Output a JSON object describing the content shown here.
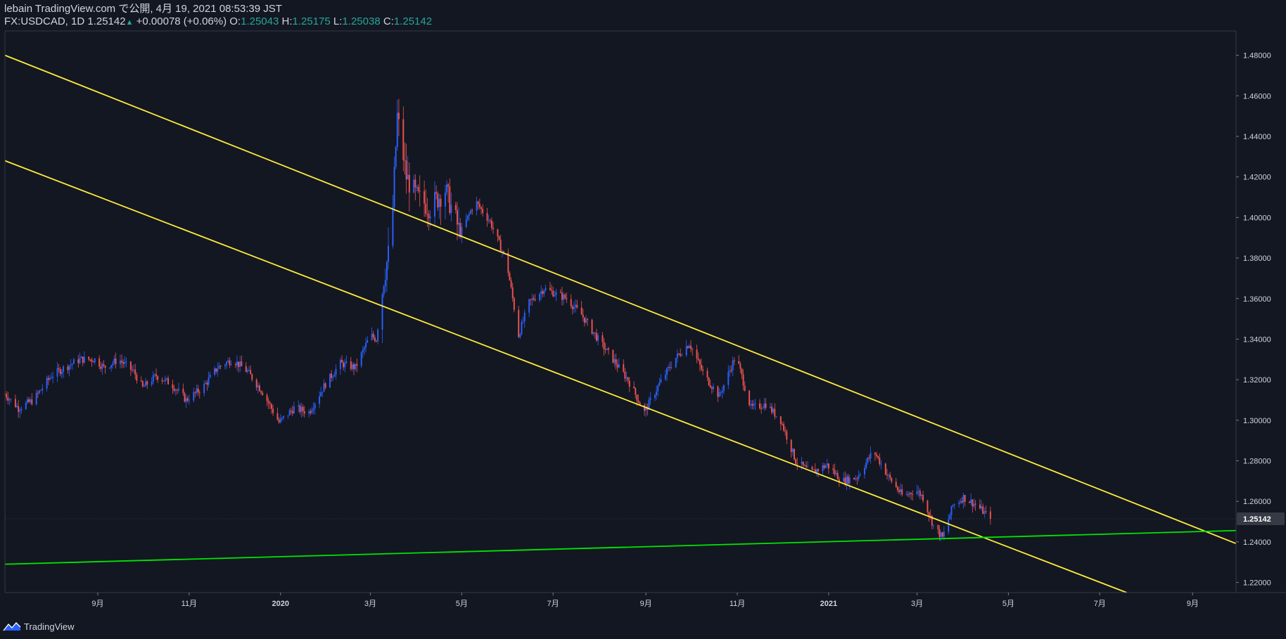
{
  "header": {
    "publisher_line": "lebain TradingView.com で公開, 4月 19, 2021 08:53:39 JST",
    "symbol": "FX:USDCAD, 1D",
    "last": "1.25142",
    "change_arrow": "▲",
    "change": "+0.00078 (+0.06%)",
    "o_label": "O:",
    "o_value": "1.25043",
    "h_label": "H:",
    "h_value": "1.25175",
    "l_label": "L:",
    "l_value": "1.25038",
    "c_label": "C:",
    "c_value": "1.25142"
  },
  "footer": {
    "brand": "TradingView",
    "logo_icon": "tradingview-logo-icon"
  },
  "colors": {
    "background": "#131722",
    "up_candle": "#2962ff",
    "down_candle": "#ef5350",
    "channel_lines": "#ffeb3b",
    "support_line": "#00e600",
    "axis_text": "#d1d4dc",
    "price_label_bg": "#363a45"
  },
  "chart_data": {
    "type": "candlestick",
    "symbol": "FX:USDCAD",
    "interval": "1D",
    "y_axis": {
      "ticks": [
        "1.48000",
        "1.46000",
        "1.44000",
        "1.42000",
        "1.40000",
        "1.38000",
        "1.36000",
        "1.34000",
        "1.32000",
        "1.30000",
        "1.28000",
        "1.26000",
        "1.24000",
        "1.22000"
      ],
      "range": [
        1.215,
        1.492
      ],
      "current_price_label": "1.25142",
      "current_price": 1.25142
    },
    "x_axis": {
      "range": [
        "2019-07-01",
        "2021-09-30"
      ],
      "ticks": [
        {
          "date": "2019-09-01",
          "label": "9月"
        },
        {
          "date": "2019-11-01",
          "label": "11月"
        },
        {
          "date": "2020-01-01",
          "label": "2020"
        },
        {
          "date": "2020-03-01",
          "label": "3月"
        },
        {
          "date": "2020-05-01",
          "label": "5月"
        },
        {
          "date": "2020-07-01",
          "label": "7月"
        },
        {
          "date": "2020-09-01",
          "label": "9月"
        },
        {
          "date": "2020-11-01",
          "label": "11月"
        },
        {
          "date": "2021-01-01",
          "label": "2021"
        },
        {
          "date": "2021-03-01",
          "label": "3月"
        },
        {
          "date": "2021-05-01",
          "label": "5月"
        },
        {
          "date": "2021-07-01",
          "label": "7月"
        },
        {
          "date": "2021-09-01",
          "label": "9月"
        }
      ]
    },
    "price_path": [
      [
        "2019-07-01",
        1.313
      ],
      [
        "2019-07-10",
        1.306
      ],
      [
        "2019-07-20",
        1.31
      ],
      [
        "2019-08-01",
        1.322
      ],
      [
        "2019-08-10",
        1.326
      ],
      [
        "2019-08-20",
        1.33
      ],
      [
        "2019-08-30",
        1.33
      ],
      [
        "2019-09-05",
        1.326
      ],
      [
        "2019-09-15",
        1.33
      ],
      [
        "2019-09-25",
        1.324
      ],
      [
        "2019-10-01",
        1.316
      ],
      [
        "2019-10-10",
        1.322
      ],
      [
        "2019-10-20",
        1.318
      ],
      [
        "2019-10-30",
        1.31
      ],
      [
        "2019-11-10",
        1.316
      ],
      [
        "2019-11-20",
        1.326
      ],
      [
        "2019-11-30",
        1.33
      ],
      [
        "2019-12-10",
        1.324
      ],
      [
        "2019-12-20",
        1.314
      ],
      [
        "2019-12-31",
        1.299
      ],
      [
        "2020-01-10",
        1.306
      ],
      [
        "2020-01-20",
        1.304
      ],
      [
        "2020-01-31",
        1.318
      ],
      [
        "2020-02-10",
        1.328
      ],
      [
        "2020-02-20",
        1.326
      ],
      [
        "2020-03-01",
        1.342
      ],
      [
        "2020-03-05",
        1.34
      ],
      [
        "2020-03-10",
        1.37
      ],
      [
        "2020-03-15",
        1.39
      ],
      [
        "2020-03-19",
        1.45
      ],
      [
        "2020-03-25",
        1.42
      ],
      [
        "2020-04-01",
        1.41
      ],
      [
        "2020-04-10",
        1.405
      ],
      [
        "2020-04-20",
        1.414
      ],
      [
        "2020-04-30",
        1.392
      ],
      [
        "2020-05-10",
        1.408
      ],
      [
        "2020-05-20",
        1.398
      ],
      [
        "2020-05-31",
        1.378
      ],
      [
        "2020-06-08",
        1.342
      ],
      [
        "2020-06-15",
        1.358
      ],
      [
        "2020-06-25",
        1.365
      ],
      [
        "2020-07-10",
        1.36
      ],
      [
        "2020-07-20",
        1.352
      ],
      [
        "2020-07-31",
        1.34
      ],
      [
        "2020-08-10",
        1.33
      ],
      [
        "2020-08-20",
        1.32
      ],
      [
        "2020-08-31",
        1.304
      ],
      [
        "2020-09-10",
        1.318
      ],
      [
        "2020-09-20",
        1.33
      ],
      [
        "2020-09-30",
        1.338
      ],
      [
        "2020-10-10",
        1.322
      ],
      [
        "2020-10-20",
        1.312
      ],
      [
        "2020-10-31",
        1.332
      ],
      [
        "2020-11-10",
        1.306
      ],
      [
        "2020-11-20",
        1.308
      ],
      [
        "2020-11-30",
        1.3
      ],
      [
        "2020-12-10",
        1.28
      ],
      [
        "2020-12-20",
        1.274
      ],
      [
        "2020-12-31",
        1.278
      ],
      [
        "2021-01-10",
        1.27
      ],
      [
        "2021-01-20",
        1.272
      ],
      [
        "2021-01-31",
        1.285
      ],
      [
        "2021-02-10",
        1.272
      ],
      [
        "2021-02-20",
        1.262
      ],
      [
        "2021-02-28",
        1.266
      ],
      [
        "2021-03-05",
        1.262
      ],
      [
        "2021-03-12",
        1.248
      ],
      [
        "2021-03-18",
        1.242
      ],
      [
        "2021-03-25",
        1.258
      ],
      [
        "2021-04-01",
        1.262
      ],
      [
        "2021-04-10",
        1.258
      ],
      [
        "2021-04-19",
        1.2514
      ]
    ],
    "drawings": [
      {
        "name": "upper-channel-line",
        "color": "#ffeb3b",
        "from": [
          "2019-07-01",
          1.48
        ],
        "to": [
          "2021-09-30",
          1.2392
        ]
      },
      {
        "name": "lower-channel-line",
        "color": "#ffeb3b",
        "from": [
          "2019-07-01",
          1.428
        ],
        "to": [
          "2021-07-19",
          1.215
        ]
      },
      {
        "name": "support-line",
        "color": "#00e600",
        "from": [
          "2019-07-01",
          1.229
        ],
        "to": [
          "2021-09-30",
          1.2456
        ]
      }
    ]
  }
}
